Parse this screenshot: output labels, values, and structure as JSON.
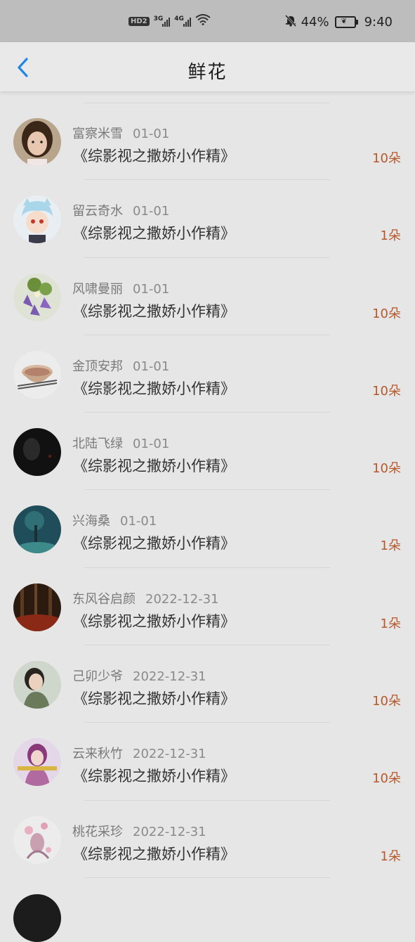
{
  "status_bar": {
    "hd": "HD",
    "hd_num": "2",
    "net1": "3G",
    "net2": "4G",
    "battery": "44%",
    "time": "9:40",
    "icons": [
      "hd-icon",
      "signal-3g-icon",
      "signal-4g-icon",
      "wifi-icon",
      "mute-bell-icon",
      "battery-saver-icon"
    ]
  },
  "nav": {
    "title": "鲜花",
    "back_icon": "chevron-left-icon",
    "accent": "#1e88e5"
  },
  "colors": {
    "count": "#b6582a",
    "name": "#7a7a7a",
    "book": "#333333"
  },
  "items": [
    {
      "name": "富察米雪",
      "date": "01-01",
      "book": "《综影视之撒娇小作精》",
      "count": "10朵"
    },
    {
      "name": "留云奇水",
      "date": "01-01",
      "book": "《综影视之撒娇小作精》",
      "count": "1朵"
    },
    {
      "name": "风啸曼丽",
      "date": "01-01",
      "book": "《综影视之撒娇小作精》",
      "count": "10朵"
    },
    {
      "name": "金顶安邦",
      "date": "01-01",
      "book": "《综影视之撒娇小作精》",
      "count": "10朵"
    },
    {
      "name": "北陆飞绿",
      "date": "01-01",
      "book": "《综影视之撒娇小作精》",
      "count": "10朵"
    },
    {
      "name": "兴海桑",
      "date": "01-01",
      "book": "《综影视之撒娇小作精》",
      "count": "1朵"
    },
    {
      "name": "东风谷启颜",
      "date": "2022-12-31",
      "book": "《综影视之撒娇小作精》",
      "count": "1朵"
    },
    {
      "name": "己卯少爷",
      "date": "2022-12-31",
      "book": "《综影视之撒娇小作精》",
      "count": "10朵"
    },
    {
      "name": "云来秋竹",
      "date": "2022-12-31",
      "book": "《综影视之撒娇小作精》",
      "count": "10朵"
    },
    {
      "name": "桃花采珍",
      "date": "2022-12-31",
      "book": "《综影视之撒娇小作精》",
      "count": "1朵"
    }
  ]
}
